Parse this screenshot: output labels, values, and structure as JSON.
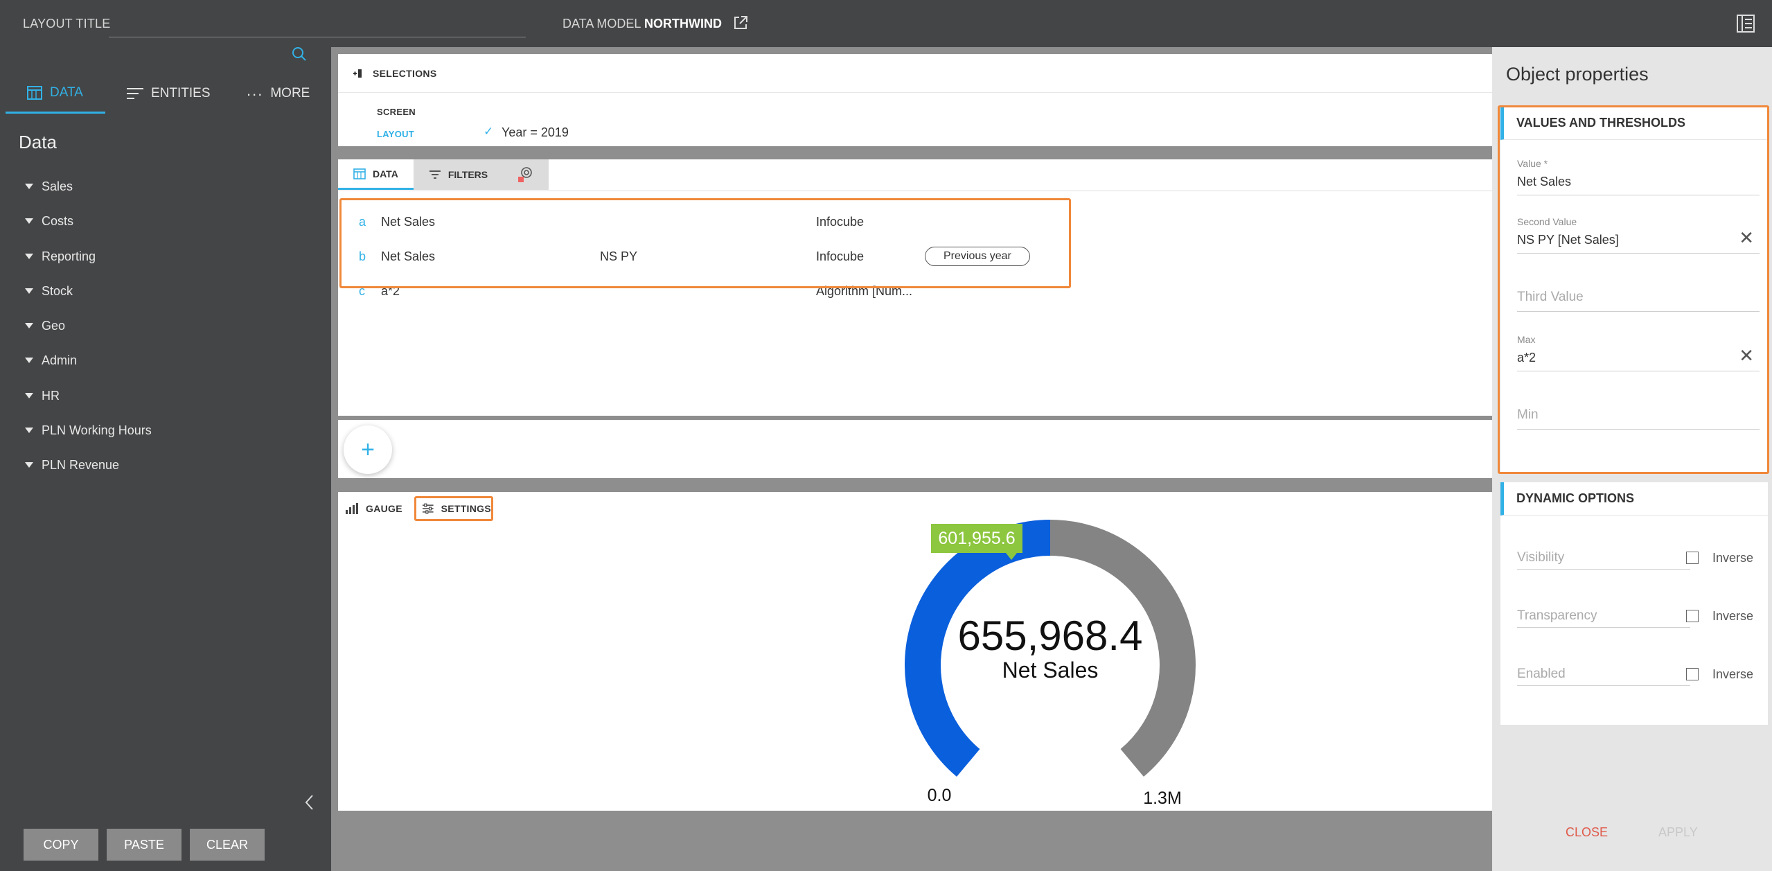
{
  "header": {
    "layout_title_label": "LAYOUT TITLE",
    "data_model_label": "DATA MODEL",
    "data_model_value": "NORTHWIND"
  },
  "sidebar": {
    "tabs": [
      {
        "label": "DATA",
        "icon": "table-icon",
        "active": true
      },
      {
        "label": "ENTITIES",
        "icon": "lines-icon",
        "active": false
      },
      {
        "label": "MORE",
        "icon": "ellipsis-icon",
        "active": false
      }
    ],
    "heading": "Data",
    "items": [
      "Sales",
      "Costs",
      "Reporting",
      "Stock",
      "Geo",
      "Admin",
      "HR",
      "PLN Working Hours",
      "PLN Revenue"
    ],
    "buttons": {
      "copy": "COPY",
      "paste": "PASTE",
      "clear": "CLEAR"
    }
  },
  "selections": {
    "title": "SELECTIONS",
    "screen_label": "SCREEN",
    "layout_label": "LAYOUT",
    "filter": "Year = 2019"
  },
  "data_tabs": {
    "data": "DATA",
    "filters": "FILTERS"
  },
  "data_rows": [
    {
      "letter": "a",
      "name": "Net Sales",
      "alias": "",
      "source": "Infocube",
      "tag": ""
    },
    {
      "letter": "b",
      "name": "Net Sales",
      "alias": "NS PY",
      "source": "Infocube",
      "tag": "Previous year"
    },
    {
      "letter": "c",
      "name": "a*2",
      "alias": "",
      "source": "Algorithm [Num...",
      "tag": ""
    }
  ],
  "add_button": "+",
  "gauge_tabs": {
    "gauge": "GAUGE",
    "settings": "SETTINGS"
  },
  "gauge": {
    "value": 655968.4,
    "value_label": "655,968.4",
    "measure": "Net Sales",
    "marker_label": "601,955.6",
    "min_label": "0.0",
    "max_label": "1.3M",
    "fill_fraction": 0.5,
    "marker_fraction": 0.46,
    "colors": {
      "fill": "#0a5fdc",
      "track": "#848484",
      "marker": "#8dc63f"
    }
  },
  "properties": {
    "title": "Object properties",
    "values_section": "VALUES AND THRESHOLDS",
    "value_label": "Value *",
    "value": "Net Sales",
    "second_label": "Second Value",
    "second_value": "NS PY [Net Sales]",
    "third_placeholder": "Third Value",
    "max_label": "Max",
    "max_value": "a*2",
    "min_placeholder": "Min",
    "dynamic_section": "DYNAMIC OPTIONS",
    "visibility": "Visibility",
    "transparency": "Transparency",
    "enabled": "Enabled",
    "inverse": "Inverse",
    "close": "CLOSE",
    "apply": "APPLY"
  },
  "colors": {
    "accent": "#31b1e6",
    "highlight": "#f0883a",
    "close": "#e05a4a"
  }
}
